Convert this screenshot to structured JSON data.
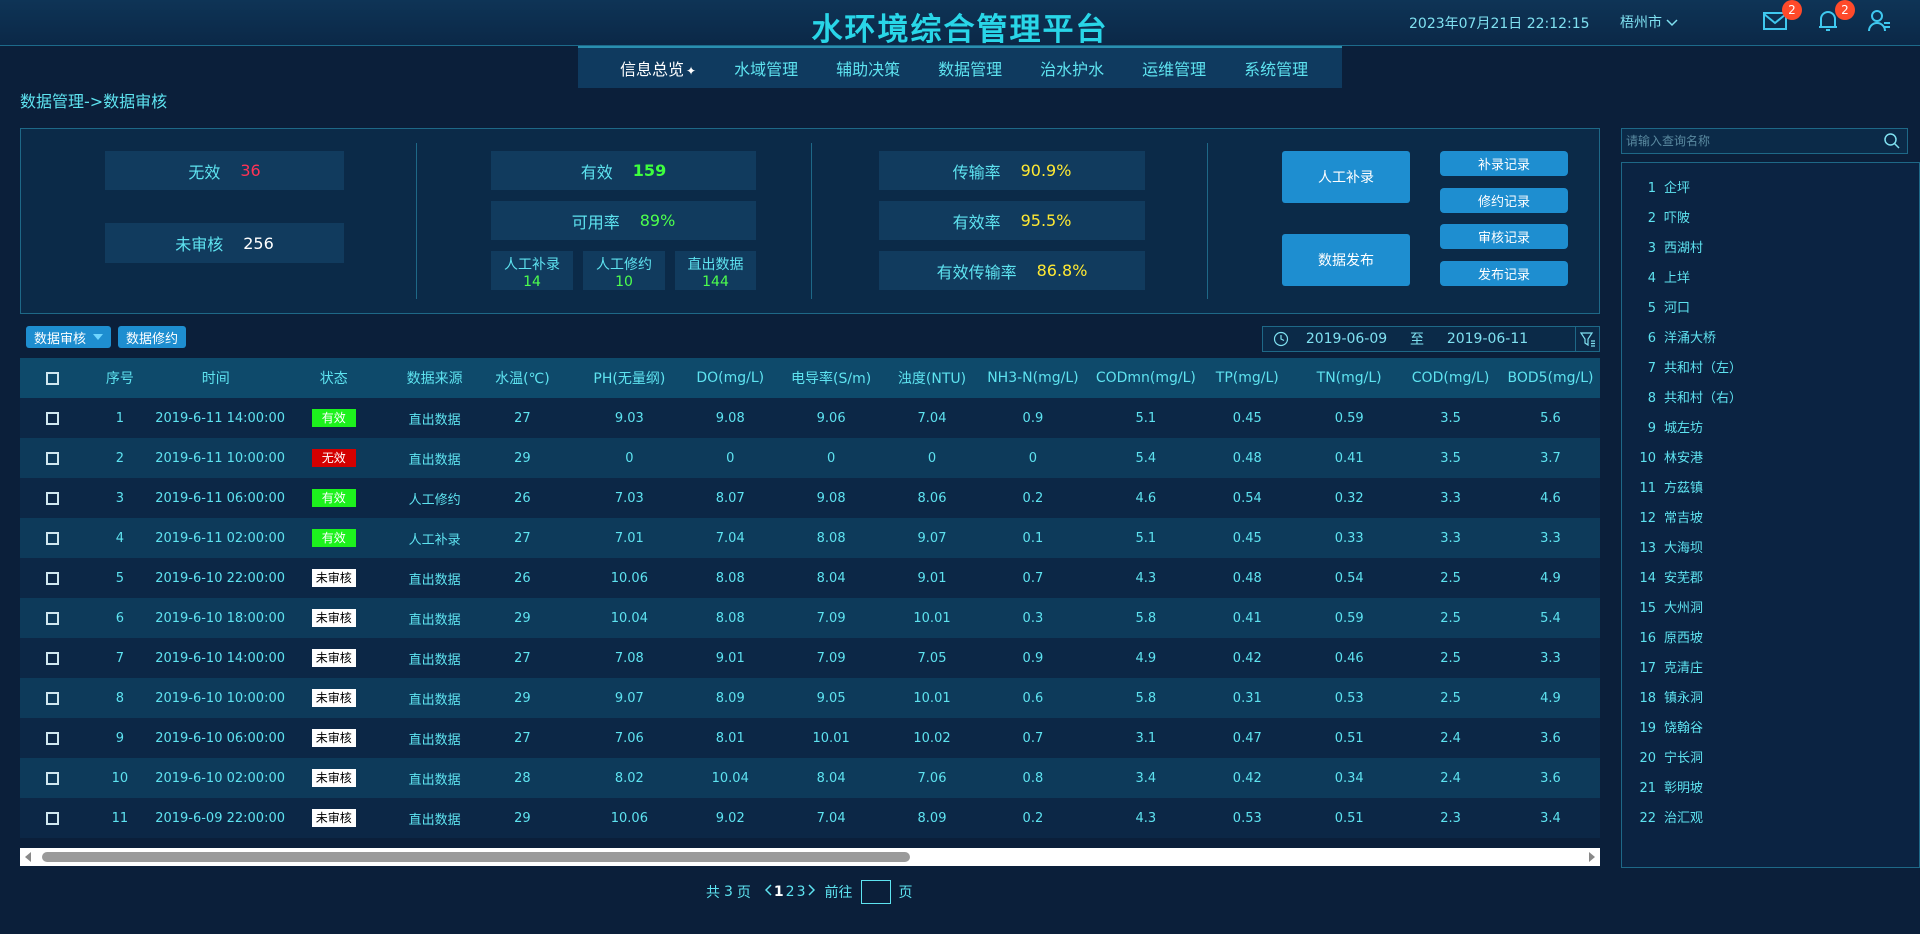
{
  "header": {
    "title": "水环境综合管理平台",
    "datetime": "2023年07月21日 22:12:15",
    "city": "梧州市",
    "mail_badge": "2",
    "bell_badge": "2"
  },
  "nav": {
    "items": [
      "信息总览",
      "水域管理",
      "辅助决策",
      "数据管理",
      "治水护水",
      "运维管理",
      "系统管理"
    ]
  },
  "breadcrumb": "数据管理->数据审核",
  "stats": {
    "invalid_label": "无效",
    "invalid_value": "36",
    "pending_label": "未审核",
    "pending_value": "256",
    "valid_label": "有效",
    "valid_value": "159",
    "availability_label": "可用率",
    "availability_value": "89%",
    "manual_add_label": "人工补录",
    "manual_add_value": "14",
    "manual_edit_label": "人工修约",
    "manual_edit_value": "10",
    "direct_label": "直出数据",
    "direct_value": "144",
    "transfer_label": "传输率",
    "transfer_value": "90.9%",
    "effective_label": "有效率",
    "effective_value": "95.5%",
    "eff_transfer_label": "有效传输率",
    "eff_transfer_value": "86.8%"
  },
  "actions": {
    "manual_add": "人工补录",
    "publish": "数据发布",
    "add_records": "补录记录",
    "edit_records": "修约记录",
    "audit_records": "审核记录",
    "publish_records": "发布记录"
  },
  "toolbar": {
    "audit_tab": "数据审核",
    "revise_tab": "数据修约",
    "date_from": "2019-06-09",
    "date_to_label": "至",
    "date_to": "2019-06-11"
  },
  "table": {
    "columns": [
      "序号",
      "时间",
      "状态",
      "数据来源",
      "水温(℃)",
      "PH(无量纲)",
      "DO(mg/L)",
      "电导率(S/m)",
      "浊度(NTU)",
      "NH3-N(mg/L)",
      "CODmn(mg/L)",
      "TP(mg/L)",
      "TN(mg/L)",
      "COD(mg/L)",
      "BOD5(mg/L)"
    ],
    "rows": [
      [
        "1",
        "2019-6-11 14:00:00",
        "有效",
        "直出数据",
        "27",
        "9.03",
        "9.08",
        "9.06",
        "7.04",
        "0.9",
        "5.1",
        "0.45",
        "0.59",
        "3.5",
        "5.6"
      ],
      [
        "2",
        "2019-6-11 10:00:00",
        "无效",
        "直出数据",
        "29",
        "0",
        "0",
        "0",
        "0",
        "0",
        "5.4",
        "0.48",
        "0.41",
        "3.5",
        "3.7"
      ],
      [
        "3",
        "2019-6-11 06:00:00",
        "有效",
        "人工修约",
        "26",
        "7.03",
        "8.07",
        "9.08",
        "8.06",
        "0.2",
        "4.6",
        "0.54",
        "0.32",
        "3.3",
        "4.6"
      ],
      [
        "4",
        "2019-6-11 02:00:00",
        "有效",
        "人工补录",
        "27",
        "7.01",
        "7.04",
        "8.08",
        "9.07",
        "0.1",
        "5.1",
        "0.45",
        "0.33",
        "3.3",
        "3.3"
      ],
      [
        "5",
        "2019-6-10 22:00:00",
        "未审核",
        "直出数据",
        "26",
        "10.06",
        "8.08",
        "8.04",
        "9.01",
        "0.7",
        "4.3",
        "0.48",
        "0.54",
        "2.5",
        "4.9"
      ],
      [
        "6",
        "2019-6-10 18:00:00",
        "未审核",
        "直出数据",
        "29",
        "10.04",
        "8.08",
        "7.09",
        "10.01",
        "0.3",
        "5.8",
        "0.41",
        "0.59",
        "2.5",
        "5.4"
      ],
      [
        "7",
        "2019-6-10 14:00:00",
        "未审核",
        "直出数据",
        "27",
        "7.08",
        "9.01",
        "7.09",
        "7.05",
        "0.9",
        "4.9",
        "0.42",
        "0.46",
        "2.5",
        "3.3"
      ],
      [
        "8",
        "2019-6-10 10:00:00",
        "未审核",
        "直出数据",
        "29",
        "9.07",
        "8.09",
        "9.05",
        "10.01",
        "0.6",
        "5.8",
        "0.31",
        "0.53",
        "2.5",
        "4.9"
      ],
      [
        "9",
        "2019-6-10 06:00:00",
        "未审核",
        "直出数据",
        "27",
        "7.06",
        "8.01",
        "10.01",
        "10.02",
        "0.7",
        "3.1",
        "0.47",
        "0.51",
        "2.4",
        "3.6"
      ],
      [
        "10",
        "2019-6-10 02:00:00",
        "未审核",
        "直出数据",
        "28",
        "8.02",
        "10.04",
        "8.04",
        "7.06",
        "0.8",
        "3.4",
        "0.42",
        "0.34",
        "2.4",
        "3.6"
      ],
      [
        "11",
        "2019-6-09 22:00:00",
        "未审核",
        "直出数据",
        "29",
        "10.06",
        "9.02",
        "7.04",
        "8.09",
        "0.2",
        "4.3",
        "0.53",
        "0.51",
        "2.3",
        "3.4"
      ]
    ]
  },
  "pagination": {
    "total_prefix": "共",
    "total_pages": "3",
    "total_suffix": "页",
    "pages": [
      "1",
      "2",
      "3"
    ],
    "goto_label": "前往",
    "goto_suffix": "页"
  },
  "search": {
    "placeholder": "请输入查询名称"
  },
  "stations": [
    {
      "num": "1",
      "name": "企坪"
    },
    {
      "num": "2",
      "name": "吓陂"
    },
    {
      "num": "3",
      "name": "西湖村"
    },
    {
      "num": "4",
      "name": "上垟"
    },
    {
      "num": "5",
      "name": "河口"
    },
    {
      "num": "6",
      "name": "洋涌大桥"
    },
    {
      "num": "7",
      "name": "共和村（左）"
    },
    {
      "num": "8",
      "name": "共和村（右）"
    },
    {
      "num": "9",
      "name": "城左坊"
    },
    {
      "num": "10",
      "name": "林安港"
    },
    {
      "num": "11",
      "name": "方茲镇"
    },
    {
      "num": "12",
      "name": "常吉坡"
    },
    {
      "num": "13",
      "name": "大海坝"
    },
    {
      "num": "14",
      "name": "安芜郡"
    },
    {
      "num": "15",
      "name": "大州洞"
    },
    {
      "num": "16",
      "name": "原西坡"
    },
    {
      "num": "17",
      "name": "克清庄"
    },
    {
      "num": "18",
      "name": "镇永洞"
    },
    {
      "num": "19",
      "name": "饶翰谷"
    },
    {
      "num": "20",
      "name": "宁长洞"
    },
    {
      "num": "21",
      "name": "彰明坡"
    },
    {
      "num": "22",
      "name": "治汇观"
    }
  ]
}
